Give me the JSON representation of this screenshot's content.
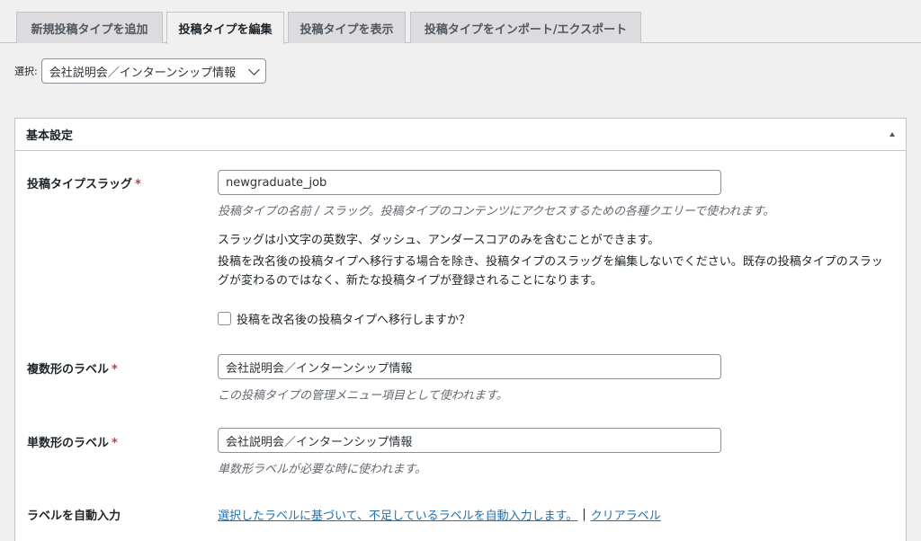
{
  "tabs": [
    {
      "label": "新規投稿タイプを追加"
    },
    {
      "label": "投稿タイプを編集"
    },
    {
      "label": "投稿タイプを表示"
    },
    {
      "label": "投稿タイプをインポート/エクスポート"
    }
  ],
  "selector": {
    "label": "選択:",
    "value": "会社説明会／インターンシップ情報"
  },
  "panel": {
    "title": "基本設定",
    "slug": {
      "label": "投稿タイプスラッグ",
      "required": "*",
      "value": "newgraduate_job",
      "desc": "投稿タイプの名前 / スラッグ。投稿タイプのコンテンツにアクセスするための各種クエリーで使われます。",
      "note1": "スラッグは小文字の英数字、ダッシュ、アンダースコアのみを含むことができます。",
      "note2": "投稿を改名後の投稿タイプへ移行する場合を除き、投稿タイプのスラッグを編集しないでください。既存の投稿タイプのスラッグが変わるのではなく、新たな投稿タイプが登録されることになります。",
      "migrate_label": "投稿を改名後の投稿タイプへ移行しますか？"
    },
    "plural": {
      "label": "複数形のラベル",
      "required": "*",
      "value": "会社説明会／インターンシップ情報",
      "desc": "この投稿タイプの管理メニュー項目として使われます。"
    },
    "singular": {
      "label": "単数形のラベル",
      "required": "*",
      "value": "会社説明会／インターンシップ情報",
      "desc": "単数形ラベルが必要な時に使われます。"
    },
    "autofill": {
      "label": "ラベルを自動入力",
      "fill_link": "選択したラベルに基づいて、不足しているラベルを自動入力します。",
      "separator": "|",
      "clear_link": "クリアラベル"
    }
  }
}
